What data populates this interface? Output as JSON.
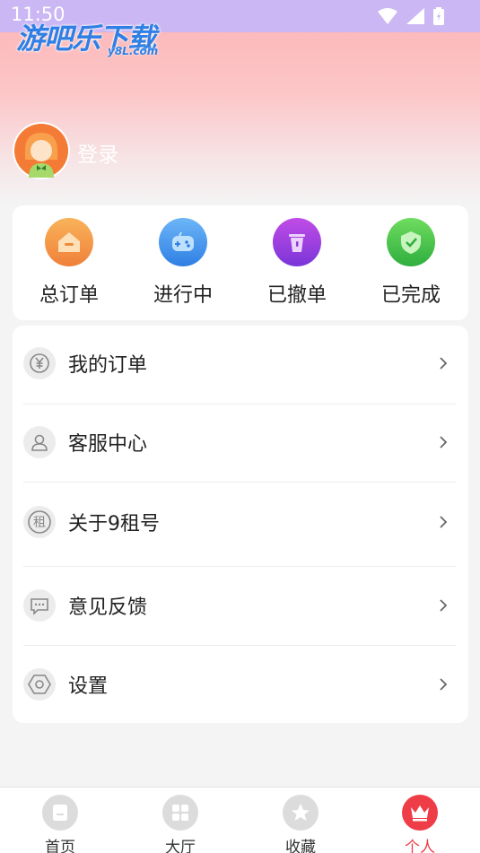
{
  "status_bar": {
    "time": "11:50"
  },
  "watermark": {
    "title": "游吧乐下载",
    "sub": "y8L.com"
  },
  "profile": {
    "login_label": "登录"
  },
  "orders": [
    {
      "label": "总订单",
      "icon": "order-all-icon",
      "color": "#f08a3c"
    },
    {
      "label": "进行中",
      "icon": "gamepad-icon",
      "color": "#2f8fe8"
    },
    {
      "label": "已撤单",
      "icon": "trash-icon",
      "color": "#8b3cdc"
    },
    {
      "label": "已完成",
      "icon": "shield-check-icon",
      "color": "#3cbf4a"
    }
  ],
  "menu": [
    {
      "label": "我的订单",
      "icon": "yuan-icon"
    },
    {
      "label": "客服中心",
      "icon": "user-icon"
    },
    {
      "label": "关于9租号",
      "icon": "zu-icon",
      "glyph": "租"
    },
    {
      "label": "意见反馈",
      "icon": "message-icon"
    },
    {
      "label": "设置",
      "icon": "hexagon-settings-icon"
    }
  ],
  "tabs": [
    {
      "label": "首页",
      "icon": "home-icon"
    },
    {
      "label": "大厅",
      "icon": "grid-icon"
    },
    {
      "label": "收藏",
      "icon": "star-icon"
    },
    {
      "label": "个人",
      "icon": "crown-icon",
      "active": true
    }
  ],
  "accent": "#ef3d48"
}
